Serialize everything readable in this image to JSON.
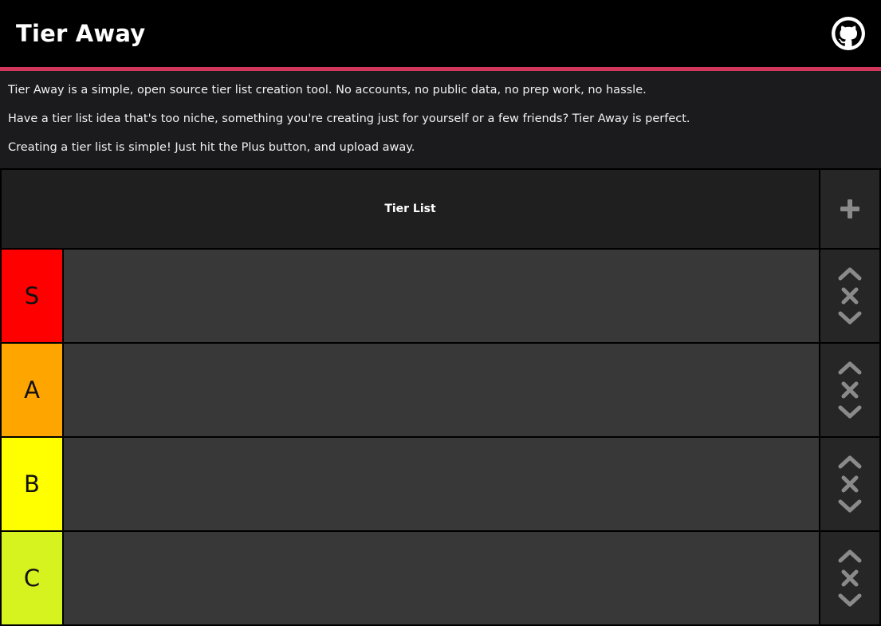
{
  "header": {
    "title": "Tier Away",
    "github_icon": "github-icon"
  },
  "intro": {
    "paragraphs": [
      "Tier Away is a simple, open source tier list creation tool. No accounts, no public data, no prep work, no hassle.",
      "Have a tier list idea that's too niche, something you're creating just for yourself or a few friends? Tier Away is perfect.",
      "Creating a tier list is simple! Just hit the Plus button, and upload away."
    ]
  },
  "table": {
    "title": "Tier List",
    "add_icon": "plus-icon",
    "tiers": [
      {
        "label": "S",
        "color": "#ff0000"
      },
      {
        "label": "A",
        "color": "#ffa500"
      },
      {
        "label": "B",
        "color": "#ffff00"
      },
      {
        "label": "C",
        "color": "#d6f21f"
      }
    ],
    "row_controls": [
      "chevron-up-icon",
      "close-icon",
      "chevron-down-icon"
    ]
  },
  "colors": {
    "accent": "#d1385c",
    "icon_gray": "#8a8a8a"
  }
}
